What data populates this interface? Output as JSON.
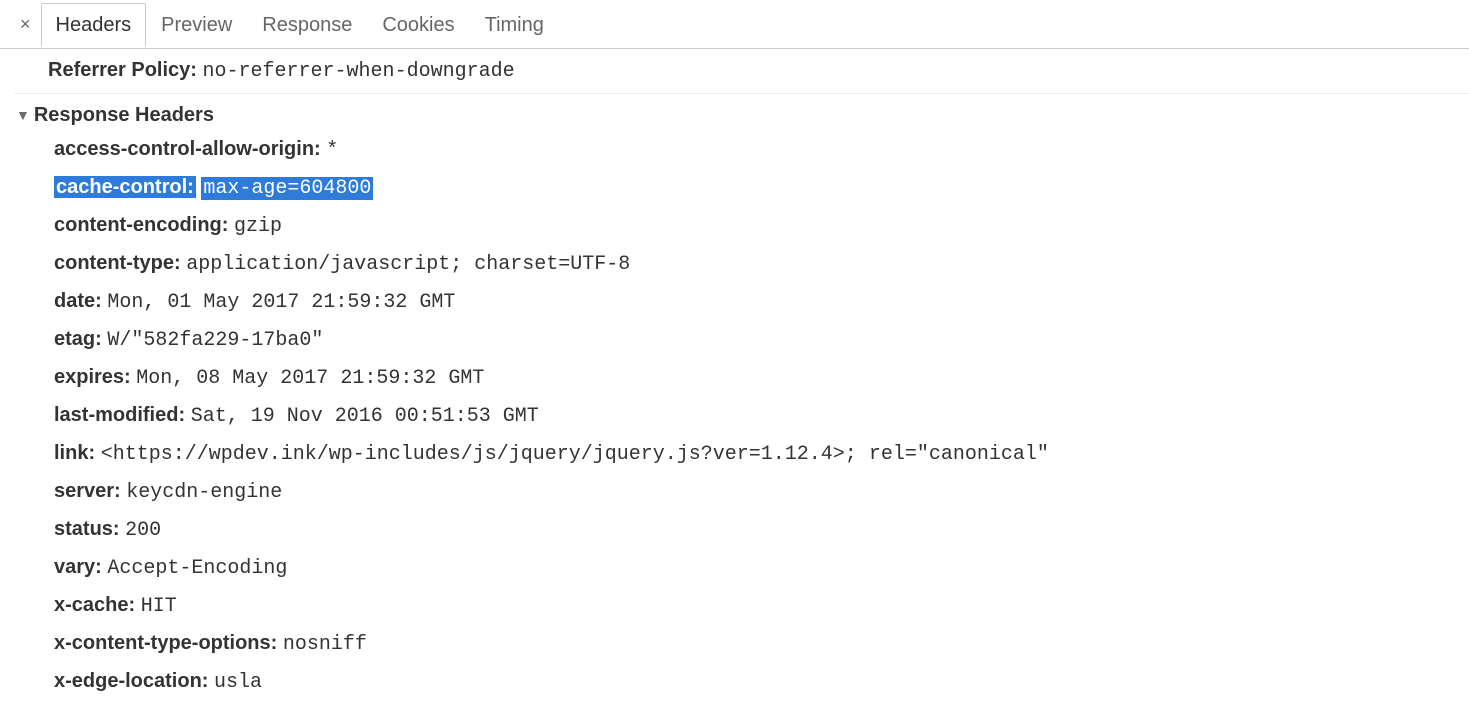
{
  "tabs": {
    "close": "×",
    "headers": "Headers",
    "preview": "Preview",
    "response": "Response",
    "cookies": "Cookies",
    "timing": "Timing"
  },
  "referrer": {
    "label": "Referrer Policy:",
    "value": "no-referrer-when-downgrade"
  },
  "responseHeadersTitle": "Response Headers",
  "headers": [
    {
      "name": "access-control-allow-origin:",
      "value": "*"
    },
    {
      "name": "cache-control:",
      "value": "max-age=604800",
      "hl": true
    },
    {
      "name": "content-encoding:",
      "value": "gzip"
    },
    {
      "name": "content-type:",
      "value": "application/javascript; charset=UTF-8"
    },
    {
      "name": "date:",
      "value": "Mon, 01 May 2017 21:59:32 GMT"
    },
    {
      "name": "etag:",
      "value": "W/\"582fa229-17ba0\""
    },
    {
      "name": "expires:",
      "value": "Mon, 08 May 2017 21:59:32 GMT"
    },
    {
      "name": "last-modified:",
      "value": "Sat, 19 Nov 2016 00:51:53 GMT"
    },
    {
      "name": "link:",
      "value": "<https://wpdev.ink/wp-includes/js/jquery/jquery.js?ver=1.12.4>; rel=\"canonical\""
    },
    {
      "name": "server:",
      "value": "keycdn-engine"
    },
    {
      "name": "status:",
      "value": "200"
    },
    {
      "name": "vary:",
      "value": "Accept-Encoding"
    },
    {
      "name": "x-cache:",
      "value": "HIT"
    },
    {
      "name": "x-content-type-options:",
      "value": "nosniff"
    },
    {
      "name": "x-edge-location:",
      "value": "usla"
    }
  ]
}
